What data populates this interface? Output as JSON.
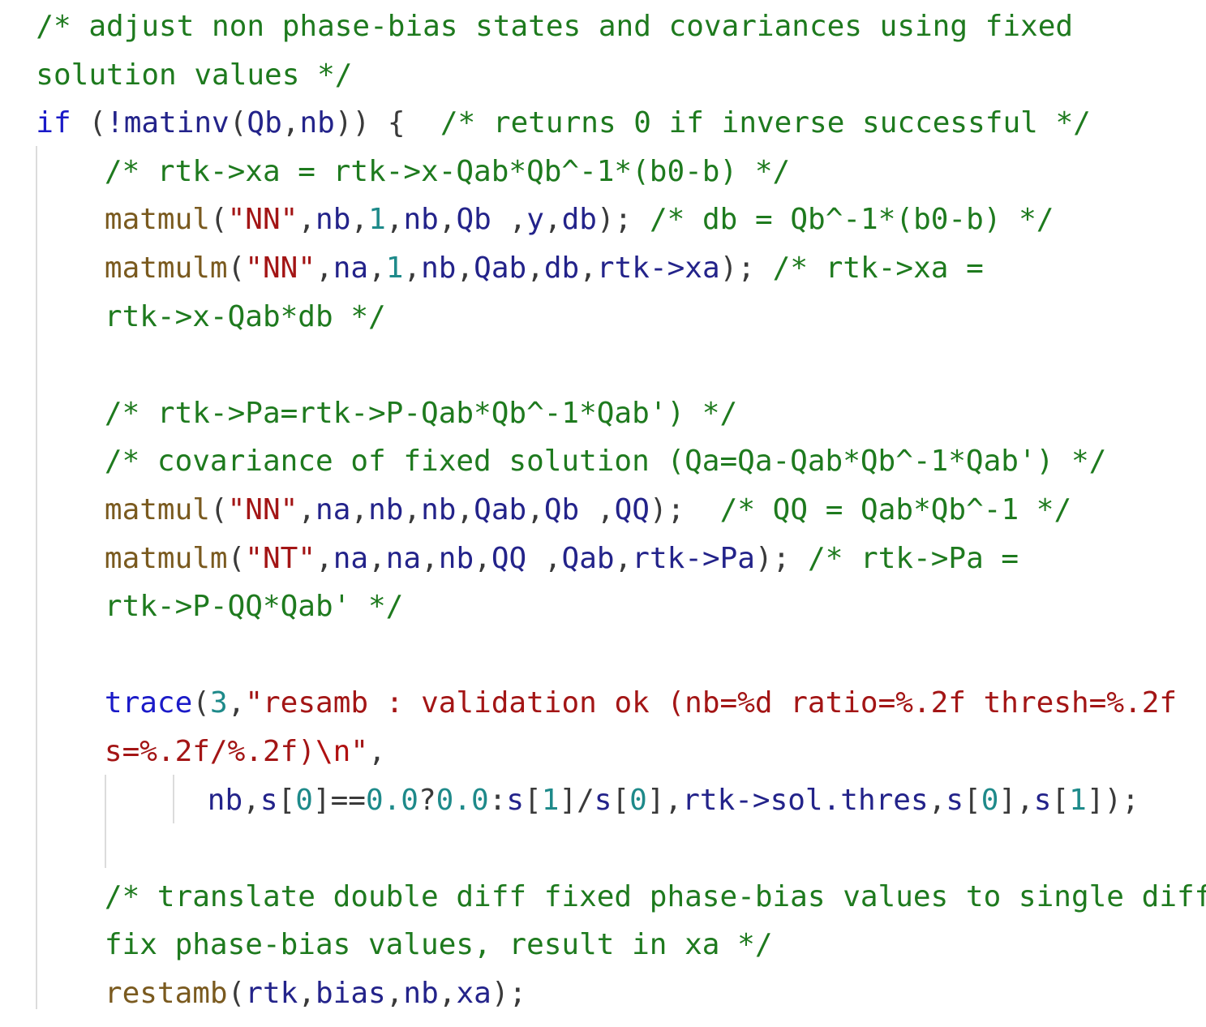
{
  "editor": {
    "theme_colors": {
      "comment": "#1e7a1e",
      "keyword": "#1a1ac8",
      "function": "#7a5a1f",
      "string": "#a31515",
      "number": "#1e8a8a",
      "identifier": "#23238a"
    },
    "lines": [
      {
        "indent": 1,
        "tokens": [
          {
            "t": "cm",
            "v": "/* adjust non phase-bias states and covariances using fixed"
          }
        ]
      },
      {
        "indent": 1,
        "tokens": [
          {
            "t": "cm",
            "v": "solution values */"
          }
        ]
      },
      {
        "indent": 1,
        "tokens": [
          {
            "t": "kw",
            "v": "if"
          },
          {
            "t": "punc",
            "v": " ("
          },
          {
            "t": "id",
            "v": "!matinv"
          },
          {
            "t": "punc",
            "v": "("
          },
          {
            "t": "id",
            "v": "Qb"
          },
          {
            "t": "punc",
            "v": ","
          },
          {
            "t": "id",
            "v": "nb"
          },
          {
            "t": "punc",
            "v": ")) {  "
          },
          {
            "t": "cm",
            "v": "/* returns 0 if inverse successful */"
          }
        ]
      },
      {
        "indent": 3,
        "tokens": [
          {
            "t": "cm",
            "v": "/* rtk->xa = rtk->x-Qab*Qb^-1*(b0-b) */"
          }
        ]
      },
      {
        "indent": 3,
        "tokens": [
          {
            "t": "fn",
            "v": "matmul"
          },
          {
            "t": "punc",
            "v": "("
          },
          {
            "t": "str2",
            "v": "\"NN\""
          },
          {
            "t": "punc",
            "v": ","
          },
          {
            "t": "id",
            "v": "nb"
          },
          {
            "t": "punc",
            "v": ","
          },
          {
            "t": "num",
            "v": "1"
          },
          {
            "t": "punc",
            "v": ","
          },
          {
            "t": "id",
            "v": "nb"
          },
          {
            "t": "punc",
            "v": ","
          },
          {
            "t": "id",
            "v": "Qb"
          },
          {
            "t": "punc",
            "v": " ,"
          },
          {
            "t": "id",
            "v": "y"
          },
          {
            "t": "punc",
            "v": ","
          },
          {
            "t": "id",
            "v": "db"
          },
          {
            "t": "punc",
            "v": "); "
          },
          {
            "t": "cm",
            "v": "/* db = Qb^-1*(b0-b) */"
          }
        ]
      },
      {
        "indent": 3,
        "tokens": [
          {
            "t": "fn",
            "v": "matmulm"
          },
          {
            "t": "punc",
            "v": "("
          },
          {
            "t": "str2",
            "v": "\"NN\""
          },
          {
            "t": "punc",
            "v": ","
          },
          {
            "t": "id",
            "v": "na"
          },
          {
            "t": "punc",
            "v": ","
          },
          {
            "t": "num",
            "v": "1"
          },
          {
            "t": "punc",
            "v": ","
          },
          {
            "t": "id",
            "v": "nb"
          },
          {
            "t": "punc",
            "v": ","
          },
          {
            "t": "id",
            "v": "Qab"
          },
          {
            "t": "punc",
            "v": ","
          },
          {
            "t": "id",
            "v": "db"
          },
          {
            "t": "punc",
            "v": ","
          },
          {
            "t": "id",
            "v": "rtk->xa"
          },
          {
            "t": "punc",
            "v": "); "
          },
          {
            "t": "cm",
            "v": "/* rtk->xa ="
          }
        ]
      },
      {
        "indent": 3,
        "tokens": [
          {
            "t": "cm",
            "v": "rtk->x-Qab*db */"
          }
        ]
      },
      {
        "indent": 3,
        "tokens": []
      },
      {
        "indent": 3,
        "tokens": [
          {
            "t": "cm",
            "v": "/* rtk->Pa=rtk->P-Qab*Qb^-1*Qab') */"
          }
        ]
      },
      {
        "indent": 3,
        "tokens": [
          {
            "t": "cm",
            "v": "/* covariance of fixed solution (Qa=Qa-Qab*Qb^-1*Qab') */"
          }
        ]
      },
      {
        "indent": 3,
        "tokens": [
          {
            "t": "fn",
            "v": "matmul"
          },
          {
            "t": "punc",
            "v": "("
          },
          {
            "t": "str2",
            "v": "\"NN\""
          },
          {
            "t": "punc",
            "v": ","
          },
          {
            "t": "id",
            "v": "na"
          },
          {
            "t": "punc",
            "v": ","
          },
          {
            "t": "id",
            "v": "nb"
          },
          {
            "t": "punc",
            "v": ","
          },
          {
            "t": "id",
            "v": "nb"
          },
          {
            "t": "punc",
            "v": ","
          },
          {
            "t": "id",
            "v": "Qab"
          },
          {
            "t": "punc",
            "v": ","
          },
          {
            "t": "id",
            "v": "Qb"
          },
          {
            "t": "punc",
            "v": " ,"
          },
          {
            "t": "id",
            "v": "QQ"
          },
          {
            "t": "punc",
            "v": ");  "
          },
          {
            "t": "cm",
            "v": "/* QQ = Qab*Qb^-1 */"
          }
        ]
      },
      {
        "indent": 3,
        "tokens": [
          {
            "t": "fn",
            "v": "matmulm"
          },
          {
            "t": "punc",
            "v": "("
          },
          {
            "t": "str2",
            "v": "\"NT\""
          },
          {
            "t": "punc",
            "v": ","
          },
          {
            "t": "id",
            "v": "na"
          },
          {
            "t": "punc",
            "v": ","
          },
          {
            "t": "id",
            "v": "na"
          },
          {
            "t": "punc",
            "v": ","
          },
          {
            "t": "id",
            "v": "nb"
          },
          {
            "t": "punc",
            "v": ","
          },
          {
            "t": "id",
            "v": "QQ"
          },
          {
            "t": "punc",
            "v": " ,"
          },
          {
            "t": "id",
            "v": "Qab"
          },
          {
            "t": "punc",
            "v": ","
          },
          {
            "t": "id",
            "v": "rtk->Pa"
          },
          {
            "t": "punc",
            "v": "); "
          },
          {
            "t": "cm",
            "v": "/* rtk->Pa ="
          }
        ]
      },
      {
        "indent": 3,
        "tokens": [
          {
            "t": "cm",
            "v": "rtk->P-QQ*Qab' */"
          }
        ]
      },
      {
        "indent": 3,
        "tokens": []
      },
      {
        "indent": 3,
        "tokens": [
          {
            "t": "kw",
            "v": "trace"
          },
          {
            "t": "punc",
            "v": "("
          },
          {
            "t": "num",
            "v": "3"
          },
          {
            "t": "punc",
            "v": ","
          },
          {
            "t": "str2",
            "v": "\"resamb : validation ok (nb=%d ratio=%.2f thresh=%.2f"
          }
        ]
      },
      {
        "indent": 3,
        "tokens": [
          {
            "t": "str2",
            "v": "s=%.2f/%.2f)"
          },
          {
            "t": "esc",
            "v": "\\n"
          },
          {
            "t": "str2",
            "v": "\""
          },
          {
            "t": "punc",
            "v": ","
          }
        ]
      },
      {
        "indent": 6,
        "tokens": [
          {
            "t": "id",
            "v": "nb"
          },
          {
            "t": "punc",
            "v": ","
          },
          {
            "t": "id",
            "v": "s"
          },
          {
            "t": "punc",
            "v": "["
          },
          {
            "t": "num",
            "v": "0"
          },
          {
            "t": "punc",
            "v": "]=="
          },
          {
            "t": "num",
            "v": "0.0"
          },
          {
            "t": "punc",
            "v": "?"
          },
          {
            "t": "num",
            "v": "0.0"
          },
          {
            "t": "punc",
            "v": ":"
          },
          {
            "t": "id",
            "v": "s"
          },
          {
            "t": "punc",
            "v": "["
          },
          {
            "t": "num",
            "v": "1"
          },
          {
            "t": "punc",
            "v": "]/"
          },
          {
            "t": "id",
            "v": "s"
          },
          {
            "t": "punc",
            "v": "["
          },
          {
            "t": "num",
            "v": "0"
          },
          {
            "t": "punc",
            "v": "],"
          },
          {
            "t": "id",
            "v": "rtk->sol.thres"
          },
          {
            "t": "punc",
            "v": ","
          },
          {
            "t": "id",
            "v": "s"
          },
          {
            "t": "punc",
            "v": "["
          },
          {
            "t": "num",
            "v": "0"
          },
          {
            "t": "punc",
            "v": "],"
          },
          {
            "t": "id",
            "v": "s"
          },
          {
            "t": "punc",
            "v": "["
          },
          {
            "t": "num",
            "v": "1"
          },
          {
            "t": "punc",
            "v": "]);"
          }
        ]
      },
      {
        "indent": 3,
        "tokens": []
      },
      {
        "indent": 3,
        "tokens": [
          {
            "t": "cm",
            "v": "/* translate double diff fixed phase-bias values to single diff"
          }
        ]
      },
      {
        "indent": 3,
        "tokens": [
          {
            "t": "cm",
            "v": "fix phase-bias values, result in xa */"
          }
        ]
      },
      {
        "indent": 3,
        "tokens": [
          {
            "t": "fn",
            "v": "restamb"
          },
          {
            "t": "punc",
            "v": "("
          },
          {
            "t": "id",
            "v": "rtk"
          },
          {
            "t": "punc",
            "v": ","
          },
          {
            "t": "id",
            "v": "bias"
          },
          {
            "t": "punc",
            "v": ","
          },
          {
            "t": "id",
            "v": "nb"
          },
          {
            "t": "punc",
            "v": ","
          },
          {
            "t": "id",
            "v": "xa"
          },
          {
            "t": "punc",
            "v": ");"
          }
        ]
      }
    ]
  }
}
